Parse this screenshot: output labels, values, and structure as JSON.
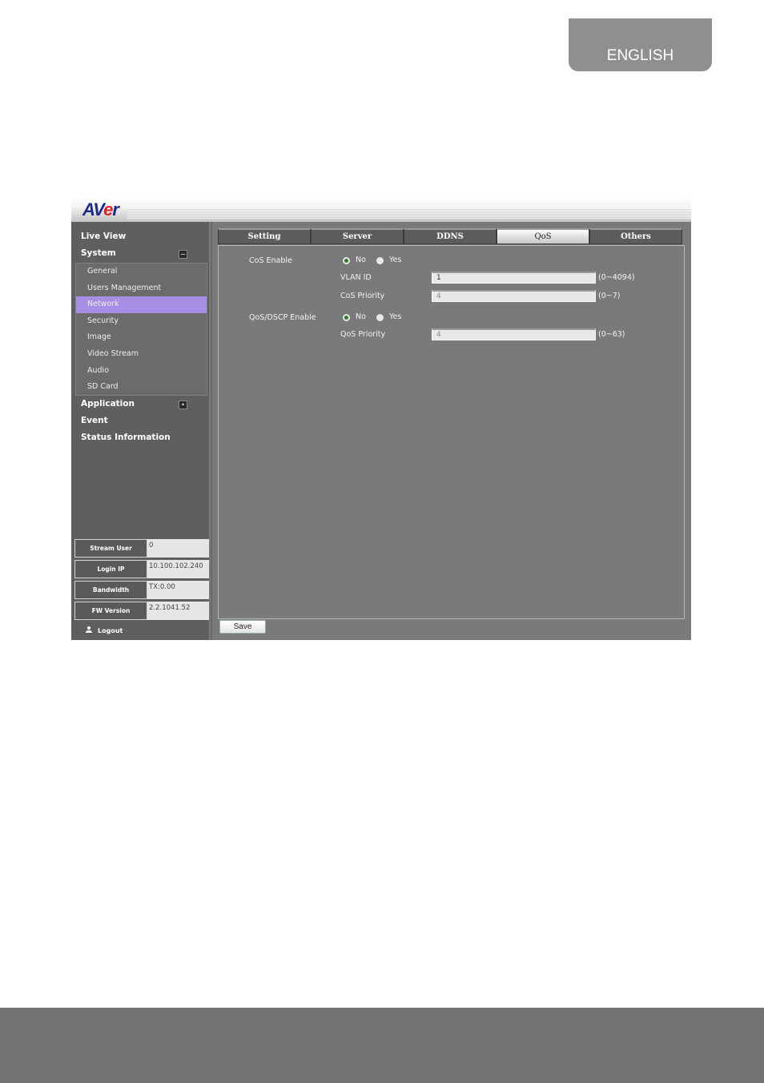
{
  "page": {
    "language_tab": "ENGLISH"
  },
  "app": {
    "logo": {
      "part1": "AV",
      "part2": "e",
      "part3": "r"
    },
    "sidebar": {
      "top_items": [
        {
          "label": "Live View"
        },
        {
          "label": "System",
          "toggle": "−"
        }
      ],
      "system_submenu": [
        {
          "label": "General"
        },
        {
          "label": "Users Management"
        },
        {
          "label": "Network",
          "active": true
        },
        {
          "label": "Security"
        },
        {
          "label": "Image"
        },
        {
          "label": "Video Stream"
        },
        {
          "label": "Audio"
        },
        {
          "label": "SD Card"
        }
      ],
      "bottom_items": [
        {
          "label": "Application",
          "toggle": "•"
        },
        {
          "label": "Event"
        },
        {
          "label": "Status Information"
        }
      ],
      "info": [
        {
          "label": "Stream User",
          "value": "0"
        },
        {
          "label": "Login IP",
          "value": "10.100.102.240"
        },
        {
          "label": "Bandwidth",
          "value": "TX:0.00"
        },
        {
          "label": "FW Version",
          "value": "2.2.1041.52"
        }
      ],
      "logout": "Logout"
    },
    "tabs": [
      {
        "label": "Setting"
      },
      {
        "label": "Server"
      },
      {
        "label": "DDNS"
      },
      {
        "label": "QoS",
        "active": true
      },
      {
        "label": "Others"
      }
    ],
    "qos": {
      "cos_enable": {
        "label": "CoS Enable",
        "options": [
          "No",
          "Yes"
        ],
        "selected": "No"
      },
      "vlan_id": {
        "label": "VLAN ID",
        "value": "1",
        "range": "(0~4094)"
      },
      "cos_priority": {
        "label": "CoS Priority",
        "value": "4",
        "range": "(0~7)"
      },
      "dscp_enable": {
        "label": "QoS/DSCP Enable",
        "options": [
          "No",
          "Yes"
        ],
        "selected": "No"
      },
      "qos_priority": {
        "label": "QoS Priority",
        "value": "4",
        "range": "(0~63)"
      }
    },
    "save_label": "Save"
  }
}
